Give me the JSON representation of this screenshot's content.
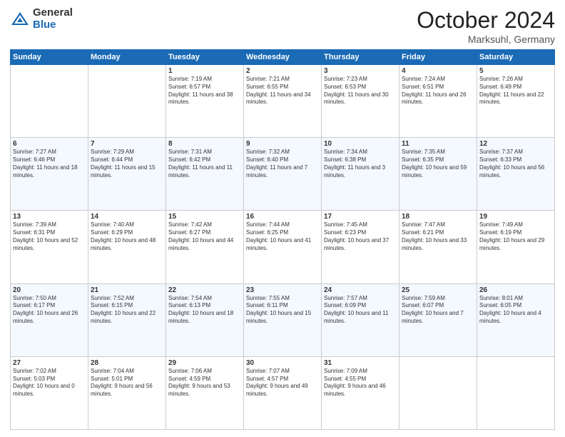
{
  "header": {
    "logo_general": "General",
    "logo_blue": "Blue",
    "month_title": "October 2024",
    "location": "Marksuhl, Germany"
  },
  "days_of_week": [
    "Sunday",
    "Monday",
    "Tuesday",
    "Wednesday",
    "Thursday",
    "Friday",
    "Saturday"
  ],
  "weeks": [
    [
      {
        "day": "",
        "sunrise": "",
        "sunset": "",
        "daylight": ""
      },
      {
        "day": "",
        "sunrise": "",
        "sunset": "",
        "daylight": ""
      },
      {
        "day": "1",
        "sunrise": "Sunrise: 7:19 AM",
        "sunset": "Sunset: 6:57 PM",
        "daylight": "Daylight: 11 hours and 38 minutes."
      },
      {
        "day": "2",
        "sunrise": "Sunrise: 7:21 AM",
        "sunset": "Sunset: 6:55 PM",
        "daylight": "Daylight: 11 hours and 34 minutes."
      },
      {
        "day": "3",
        "sunrise": "Sunrise: 7:23 AM",
        "sunset": "Sunset: 6:53 PM",
        "daylight": "Daylight: 11 hours and 30 minutes."
      },
      {
        "day": "4",
        "sunrise": "Sunrise: 7:24 AM",
        "sunset": "Sunset: 6:51 PM",
        "daylight": "Daylight: 11 hours and 26 minutes."
      },
      {
        "day": "5",
        "sunrise": "Sunrise: 7:26 AM",
        "sunset": "Sunset: 6:49 PM",
        "daylight": "Daylight: 11 hours and 22 minutes."
      }
    ],
    [
      {
        "day": "6",
        "sunrise": "Sunrise: 7:27 AM",
        "sunset": "Sunset: 6:46 PM",
        "daylight": "Daylight: 11 hours and 18 minutes."
      },
      {
        "day": "7",
        "sunrise": "Sunrise: 7:29 AM",
        "sunset": "Sunset: 6:44 PM",
        "daylight": "Daylight: 11 hours and 15 minutes."
      },
      {
        "day": "8",
        "sunrise": "Sunrise: 7:31 AM",
        "sunset": "Sunset: 6:42 PM",
        "daylight": "Daylight: 11 hours and 11 minutes."
      },
      {
        "day": "9",
        "sunrise": "Sunrise: 7:32 AM",
        "sunset": "Sunset: 6:40 PM",
        "daylight": "Daylight: 11 hours and 7 minutes."
      },
      {
        "day": "10",
        "sunrise": "Sunrise: 7:34 AM",
        "sunset": "Sunset: 6:38 PM",
        "daylight": "Daylight: 11 hours and 3 minutes."
      },
      {
        "day": "11",
        "sunrise": "Sunrise: 7:35 AM",
        "sunset": "Sunset: 6:35 PM",
        "daylight": "Daylight: 10 hours and 59 minutes."
      },
      {
        "day": "12",
        "sunrise": "Sunrise: 7:37 AM",
        "sunset": "Sunset: 6:33 PM",
        "daylight": "Daylight: 10 hours and 56 minutes."
      }
    ],
    [
      {
        "day": "13",
        "sunrise": "Sunrise: 7:39 AM",
        "sunset": "Sunset: 6:31 PM",
        "daylight": "Daylight: 10 hours and 52 minutes."
      },
      {
        "day": "14",
        "sunrise": "Sunrise: 7:40 AM",
        "sunset": "Sunset: 6:29 PM",
        "daylight": "Daylight: 10 hours and 48 minutes."
      },
      {
        "day": "15",
        "sunrise": "Sunrise: 7:42 AM",
        "sunset": "Sunset: 6:27 PM",
        "daylight": "Daylight: 10 hours and 44 minutes."
      },
      {
        "day": "16",
        "sunrise": "Sunrise: 7:44 AM",
        "sunset": "Sunset: 6:25 PM",
        "daylight": "Daylight: 10 hours and 41 minutes."
      },
      {
        "day": "17",
        "sunrise": "Sunrise: 7:45 AM",
        "sunset": "Sunset: 6:23 PM",
        "daylight": "Daylight: 10 hours and 37 minutes."
      },
      {
        "day": "18",
        "sunrise": "Sunrise: 7:47 AM",
        "sunset": "Sunset: 6:21 PM",
        "daylight": "Daylight: 10 hours and 33 minutes."
      },
      {
        "day": "19",
        "sunrise": "Sunrise: 7:49 AM",
        "sunset": "Sunset: 6:19 PM",
        "daylight": "Daylight: 10 hours and 29 minutes."
      }
    ],
    [
      {
        "day": "20",
        "sunrise": "Sunrise: 7:50 AM",
        "sunset": "Sunset: 6:17 PM",
        "daylight": "Daylight: 10 hours and 26 minutes."
      },
      {
        "day": "21",
        "sunrise": "Sunrise: 7:52 AM",
        "sunset": "Sunset: 6:15 PM",
        "daylight": "Daylight: 10 hours and 22 minutes."
      },
      {
        "day": "22",
        "sunrise": "Sunrise: 7:54 AM",
        "sunset": "Sunset: 6:13 PM",
        "daylight": "Daylight: 10 hours and 18 minutes."
      },
      {
        "day": "23",
        "sunrise": "Sunrise: 7:55 AM",
        "sunset": "Sunset: 6:11 PM",
        "daylight": "Daylight: 10 hours and 15 minutes."
      },
      {
        "day": "24",
        "sunrise": "Sunrise: 7:57 AM",
        "sunset": "Sunset: 6:09 PM",
        "daylight": "Daylight: 10 hours and 11 minutes."
      },
      {
        "day": "25",
        "sunrise": "Sunrise: 7:59 AM",
        "sunset": "Sunset: 6:07 PM",
        "daylight": "Daylight: 10 hours and 7 minutes."
      },
      {
        "day": "26",
        "sunrise": "Sunrise: 8:01 AM",
        "sunset": "Sunset: 6:05 PM",
        "daylight": "Daylight: 10 hours and 4 minutes."
      }
    ],
    [
      {
        "day": "27",
        "sunrise": "Sunrise: 7:02 AM",
        "sunset": "Sunset: 5:03 PM",
        "daylight": "Daylight: 10 hours and 0 minutes."
      },
      {
        "day": "28",
        "sunrise": "Sunrise: 7:04 AM",
        "sunset": "Sunset: 5:01 PM",
        "daylight": "Daylight: 9 hours and 56 minutes."
      },
      {
        "day": "29",
        "sunrise": "Sunrise: 7:06 AM",
        "sunset": "Sunset: 4:59 PM",
        "daylight": "Daylight: 9 hours and 53 minutes."
      },
      {
        "day": "30",
        "sunrise": "Sunrise: 7:07 AM",
        "sunset": "Sunset: 4:57 PM",
        "daylight": "Daylight: 9 hours and 49 minutes."
      },
      {
        "day": "31",
        "sunrise": "Sunrise: 7:09 AM",
        "sunset": "Sunset: 4:55 PM",
        "daylight": "Daylight: 9 hours and 46 minutes."
      },
      {
        "day": "",
        "sunrise": "",
        "sunset": "",
        "daylight": ""
      },
      {
        "day": "",
        "sunrise": "",
        "sunset": "",
        "daylight": ""
      }
    ]
  ]
}
